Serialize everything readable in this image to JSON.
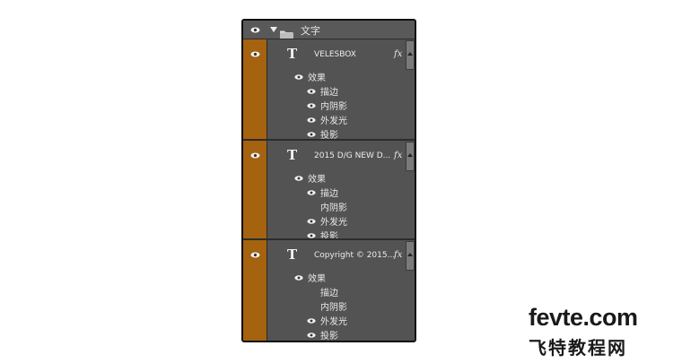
{
  "panel": {
    "group": {
      "label": "文字"
    },
    "layers": [
      {
        "name": "VELESBOX",
        "fx": "fx",
        "effects_title": "效果",
        "effects": [
          "描边",
          "内阴影",
          "外发光",
          "投影"
        ],
        "effect_visible": [
          true,
          true,
          true,
          true
        ]
      },
      {
        "name": "2015 D/G   NEW D...",
        "fx": "fx",
        "effects_title": "效果",
        "effects": [
          "描边",
          "内阴影",
          "外发光",
          "投影"
        ],
        "effect_visible": [
          true,
          false,
          true,
          true
        ]
      },
      {
        "name": "Copyright © 2015...",
        "fx": "fx",
        "effects_title": "效果",
        "effects": [
          "描边",
          "内阴影",
          "外发光",
          "投影"
        ],
        "effect_visible": [
          false,
          false,
          true,
          true
        ]
      }
    ]
  },
  "watermark": {
    "line1": "fevte.com",
    "line2": "飞特教程网"
  },
  "colors": {
    "visibility_column": "#a5620f",
    "panel_bg": "#535353",
    "text": "#e8e8e8"
  }
}
